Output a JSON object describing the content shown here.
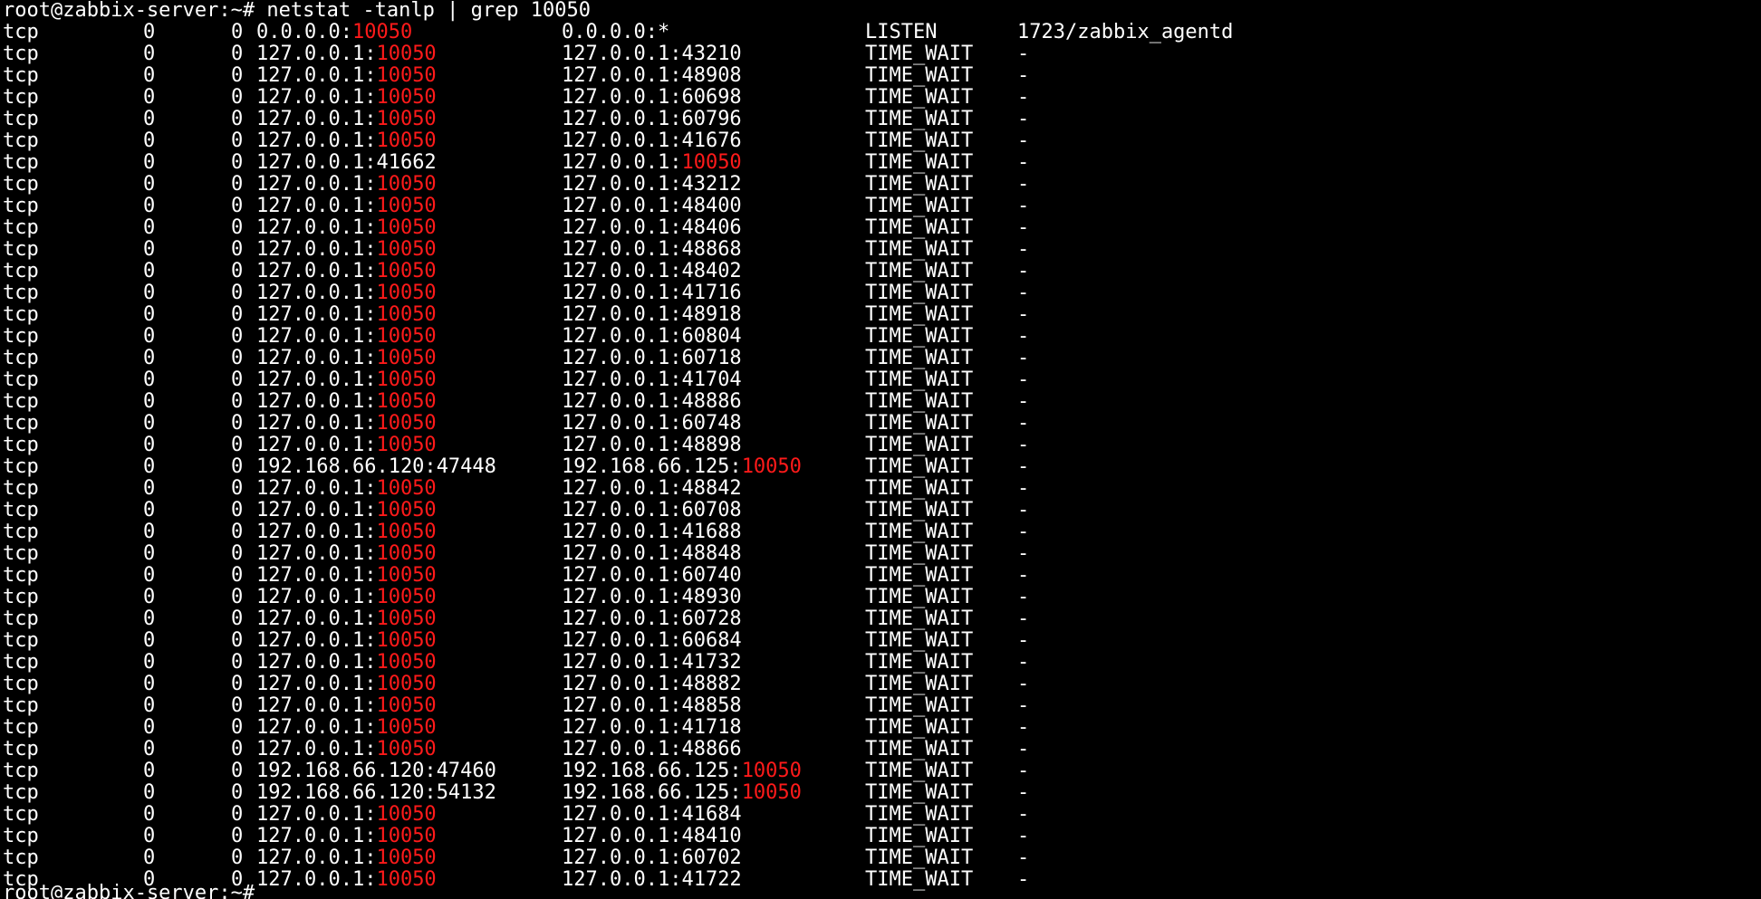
{
  "prompt": "root@zabbix-server:~#",
  "command": "netstat -tanlp | grep 10050",
  "highlight_term": "10050",
  "colors": {
    "background": "#000000",
    "text": "#ffffff",
    "highlight": "#ff1a1a"
  },
  "rows": [
    {
      "proto": "tcp",
      "recv_q": "0",
      "send_q": "0",
      "local": "0.0.0.0:10050",
      "foreign": "0.0.0.0:*",
      "state": "LISTEN",
      "pid_program": "1723/zabbix_agentd"
    },
    {
      "proto": "tcp",
      "recv_q": "0",
      "send_q": "0",
      "local": "127.0.0.1:10050",
      "foreign": "127.0.0.1:43210",
      "state": "TIME_WAIT",
      "pid_program": "-"
    },
    {
      "proto": "tcp",
      "recv_q": "0",
      "send_q": "0",
      "local": "127.0.0.1:10050",
      "foreign": "127.0.0.1:48908",
      "state": "TIME_WAIT",
      "pid_program": "-"
    },
    {
      "proto": "tcp",
      "recv_q": "0",
      "send_q": "0",
      "local": "127.0.0.1:10050",
      "foreign": "127.0.0.1:60698",
      "state": "TIME_WAIT",
      "pid_program": "-"
    },
    {
      "proto": "tcp",
      "recv_q": "0",
      "send_q": "0",
      "local": "127.0.0.1:10050",
      "foreign": "127.0.0.1:60796",
      "state": "TIME_WAIT",
      "pid_program": "-"
    },
    {
      "proto": "tcp",
      "recv_q": "0",
      "send_q": "0",
      "local": "127.0.0.1:10050",
      "foreign": "127.0.0.1:41676",
      "state": "TIME_WAIT",
      "pid_program": "-"
    },
    {
      "proto": "tcp",
      "recv_q": "0",
      "send_q": "0",
      "local": "127.0.0.1:41662",
      "foreign": "127.0.0.1:10050",
      "state": "TIME_WAIT",
      "pid_program": "-"
    },
    {
      "proto": "tcp",
      "recv_q": "0",
      "send_q": "0",
      "local": "127.0.0.1:10050",
      "foreign": "127.0.0.1:43212",
      "state": "TIME_WAIT",
      "pid_program": "-"
    },
    {
      "proto": "tcp",
      "recv_q": "0",
      "send_q": "0",
      "local": "127.0.0.1:10050",
      "foreign": "127.0.0.1:48400",
      "state": "TIME_WAIT",
      "pid_program": "-"
    },
    {
      "proto": "tcp",
      "recv_q": "0",
      "send_q": "0",
      "local": "127.0.0.1:10050",
      "foreign": "127.0.0.1:48406",
      "state": "TIME_WAIT",
      "pid_program": "-"
    },
    {
      "proto": "tcp",
      "recv_q": "0",
      "send_q": "0",
      "local": "127.0.0.1:10050",
      "foreign": "127.0.0.1:48868",
      "state": "TIME_WAIT",
      "pid_program": "-"
    },
    {
      "proto": "tcp",
      "recv_q": "0",
      "send_q": "0",
      "local": "127.0.0.1:10050",
      "foreign": "127.0.0.1:48402",
      "state": "TIME_WAIT",
      "pid_program": "-"
    },
    {
      "proto": "tcp",
      "recv_q": "0",
      "send_q": "0",
      "local": "127.0.0.1:10050",
      "foreign": "127.0.0.1:41716",
      "state": "TIME_WAIT",
      "pid_program": "-"
    },
    {
      "proto": "tcp",
      "recv_q": "0",
      "send_q": "0",
      "local": "127.0.0.1:10050",
      "foreign": "127.0.0.1:48918",
      "state": "TIME_WAIT",
      "pid_program": "-"
    },
    {
      "proto": "tcp",
      "recv_q": "0",
      "send_q": "0",
      "local": "127.0.0.1:10050",
      "foreign": "127.0.0.1:60804",
      "state": "TIME_WAIT",
      "pid_program": "-"
    },
    {
      "proto": "tcp",
      "recv_q": "0",
      "send_q": "0",
      "local": "127.0.0.1:10050",
      "foreign": "127.0.0.1:60718",
      "state": "TIME_WAIT",
      "pid_program": "-"
    },
    {
      "proto": "tcp",
      "recv_q": "0",
      "send_q": "0",
      "local": "127.0.0.1:10050",
      "foreign": "127.0.0.1:41704",
      "state": "TIME_WAIT",
      "pid_program": "-"
    },
    {
      "proto": "tcp",
      "recv_q": "0",
      "send_q": "0",
      "local": "127.0.0.1:10050",
      "foreign": "127.0.0.1:48886",
      "state": "TIME_WAIT",
      "pid_program": "-"
    },
    {
      "proto": "tcp",
      "recv_q": "0",
      "send_q": "0",
      "local": "127.0.0.1:10050",
      "foreign": "127.0.0.1:60748",
      "state": "TIME_WAIT",
      "pid_program": "-"
    },
    {
      "proto": "tcp",
      "recv_q": "0",
      "send_q": "0",
      "local": "127.0.0.1:10050",
      "foreign": "127.0.0.1:48898",
      "state": "TIME_WAIT",
      "pid_program": "-"
    },
    {
      "proto": "tcp",
      "recv_q": "0",
      "send_q": "0",
      "local": "192.168.66.120:47448",
      "foreign": "192.168.66.125:10050",
      "state": "TIME_WAIT",
      "pid_program": "-"
    },
    {
      "proto": "tcp",
      "recv_q": "0",
      "send_q": "0",
      "local": "127.0.0.1:10050",
      "foreign": "127.0.0.1:48842",
      "state": "TIME_WAIT",
      "pid_program": "-"
    },
    {
      "proto": "tcp",
      "recv_q": "0",
      "send_q": "0",
      "local": "127.0.0.1:10050",
      "foreign": "127.0.0.1:60708",
      "state": "TIME_WAIT",
      "pid_program": "-"
    },
    {
      "proto": "tcp",
      "recv_q": "0",
      "send_q": "0",
      "local": "127.0.0.1:10050",
      "foreign": "127.0.0.1:41688",
      "state": "TIME_WAIT",
      "pid_program": "-"
    },
    {
      "proto": "tcp",
      "recv_q": "0",
      "send_q": "0",
      "local": "127.0.0.1:10050",
      "foreign": "127.0.0.1:48848",
      "state": "TIME_WAIT",
      "pid_program": "-"
    },
    {
      "proto": "tcp",
      "recv_q": "0",
      "send_q": "0",
      "local": "127.0.0.1:10050",
      "foreign": "127.0.0.1:60740",
      "state": "TIME_WAIT",
      "pid_program": "-"
    },
    {
      "proto": "tcp",
      "recv_q": "0",
      "send_q": "0",
      "local": "127.0.0.1:10050",
      "foreign": "127.0.0.1:48930",
      "state": "TIME_WAIT",
      "pid_program": "-"
    },
    {
      "proto": "tcp",
      "recv_q": "0",
      "send_q": "0",
      "local": "127.0.0.1:10050",
      "foreign": "127.0.0.1:60728",
      "state": "TIME_WAIT",
      "pid_program": "-"
    },
    {
      "proto": "tcp",
      "recv_q": "0",
      "send_q": "0",
      "local": "127.0.0.1:10050",
      "foreign": "127.0.0.1:60684",
      "state": "TIME_WAIT",
      "pid_program": "-"
    },
    {
      "proto": "tcp",
      "recv_q": "0",
      "send_q": "0",
      "local": "127.0.0.1:10050",
      "foreign": "127.0.0.1:41732",
      "state": "TIME_WAIT",
      "pid_program": "-"
    },
    {
      "proto": "tcp",
      "recv_q": "0",
      "send_q": "0",
      "local": "127.0.0.1:10050",
      "foreign": "127.0.0.1:48882",
      "state": "TIME_WAIT",
      "pid_program": "-"
    },
    {
      "proto": "tcp",
      "recv_q": "0",
      "send_q": "0",
      "local": "127.0.0.1:10050",
      "foreign": "127.0.0.1:48858",
      "state": "TIME_WAIT",
      "pid_program": "-"
    },
    {
      "proto": "tcp",
      "recv_q": "0",
      "send_q": "0",
      "local": "127.0.0.1:10050",
      "foreign": "127.0.0.1:41718",
      "state": "TIME_WAIT",
      "pid_program": "-"
    },
    {
      "proto": "tcp",
      "recv_q": "0",
      "send_q": "0",
      "local": "127.0.0.1:10050",
      "foreign": "127.0.0.1:48866",
      "state": "TIME_WAIT",
      "pid_program": "-"
    },
    {
      "proto": "tcp",
      "recv_q": "0",
      "send_q": "0",
      "local": "192.168.66.120:47460",
      "foreign": "192.168.66.125:10050",
      "state": "TIME_WAIT",
      "pid_program": "-"
    },
    {
      "proto": "tcp",
      "recv_q": "0",
      "send_q": "0",
      "local": "192.168.66.120:54132",
      "foreign": "192.168.66.125:10050",
      "state": "TIME_WAIT",
      "pid_program": "-"
    },
    {
      "proto": "tcp",
      "recv_q": "0",
      "send_q": "0",
      "local": "127.0.0.1:10050",
      "foreign": "127.0.0.1:41684",
      "state": "TIME_WAIT",
      "pid_program": "-"
    },
    {
      "proto": "tcp",
      "recv_q": "0",
      "send_q": "0",
      "local": "127.0.0.1:10050",
      "foreign": "127.0.0.1:48410",
      "state": "TIME_WAIT",
      "pid_program": "-"
    },
    {
      "proto": "tcp",
      "recv_q": "0",
      "send_q": "0",
      "local": "127.0.0.1:10050",
      "foreign": "127.0.0.1:60702",
      "state": "TIME_WAIT",
      "pid_program": "-"
    },
    {
      "proto": "tcp",
      "recv_q": "0",
      "send_q": "0",
      "local": "127.0.0.1:10050",
      "foreign": "127.0.0.1:41722",
      "state": "TIME_WAIT",
      "pid_program": "-"
    }
  ],
  "last_prompt": "root@zabbix-server:~#"
}
